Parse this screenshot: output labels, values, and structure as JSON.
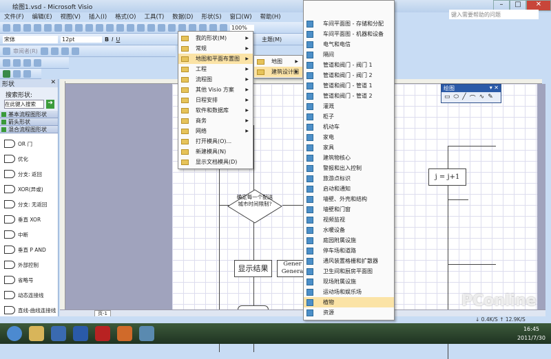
{
  "window": {
    "title": "绘图1.vsd - Microsoft Visio",
    "help_placeholder": "键入需要帮助的问题"
  },
  "menubar": [
    "文件(F)",
    "编辑(E)",
    "视图(V)",
    "插入(I)",
    "格式(O)",
    "工具(T)",
    "数据(D)",
    "形状(S)",
    "窗口(W)",
    "帮助(H)"
  ],
  "toolbar": {
    "zoom": "100%",
    "font": "宋体",
    "size": "12pt",
    "theme": "主题(M)",
    "reviewer": "审阅者(R)"
  },
  "shapes_panel": {
    "title": "形状",
    "search_label": "搜索形状:",
    "search_placeholder": "在此键入搜索",
    "stencils": [
      "基本流程图形状",
      "箭头形状",
      "混合流程图形状"
    ],
    "items": [
      "OR 门",
      "优化",
      "分支: 返回",
      "XOR(异或)",
      "分支: 无返回",
      "垂直 XOR",
      "中断",
      "垂直 P AND",
      "外部控制",
      "省略号",
      "动态连接线",
      "直线-曲线连接线"
    ]
  },
  "menu1": {
    "items": [
      {
        "label": "我的形状(M)",
        "sub": true
      },
      {
        "label": "常规",
        "sub": true
      },
      {
        "label": "地图和平面布置图",
        "sub": true,
        "highlighted": true
      },
      {
        "label": "工程",
        "sub": true
      },
      {
        "label": "流程图",
        "sub": true
      },
      {
        "label": "其他 Visio 方案",
        "sub": true
      },
      {
        "label": "日程安排",
        "sub": true
      },
      {
        "label": "软件和数据库",
        "sub": true
      },
      {
        "label": "商务",
        "sub": true
      },
      {
        "label": "网络",
        "sub": true
      },
      {
        "label": "打开模具(O)...",
        "sub": false
      },
      {
        "label": "新建模具(N)",
        "sub": false
      },
      {
        "label": "显示文档模具(D)",
        "sub": false
      }
    ]
  },
  "menu2": {
    "items": [
      {
        "label": "地图",
        "highlighted": false
      },
      {
        "label": "建筑设计图",
        "highlighted": true
      }
    ]
  },
  "menu3": {
    "highlighted": "植物",
    "items": [
      "车间平面图 - 存储和分配",
      "车间平面图 - 机器和设备",
      "电气和电信",
      "隔间",
      "管道和阀门 - 阀门 1",
      "管道和阀门 - 阀门 2",
      "管道和阀门 - 管道 1",
      "管道和阀门 - 管道 2",
      "灌溉",
      "柜子",
      "机动车",
      "家电",
      "家具",
      "建筑物核心",
      "警报和出入控制",
      "旅游点标识",
      "启动和通知",
      "墙壁、外壳和结构",
      "墙壁和门窗",
      "视频监视",
      "水暖设备",
      "庭园附属设施",
      "停车场和道路",
      "通风装置格栅和扩散器",
      "卫生间和厨房平面图",
      "现场附属设施",
      "运动场和娱乐场",
      "植物",
      "资源"
    ]
  },
  "drawing_toolbar": {
    "title": "绘图"
  },
  "diagram": {
    "decision": "确定每一个配送城市时间限制?",
    "result": "显示结果",
    "generate": "Gener Genera",
    "increment": "j = j+1"
  },
  "page_tab": "页-1",
  "network": {
    "down": "0.4K/S",
    "up": "12.9K/S"
  },
  "clock": {
    "time": "16:45",
    "date": "2011/7/30"
  },
  "watermark": "PConline"
}
